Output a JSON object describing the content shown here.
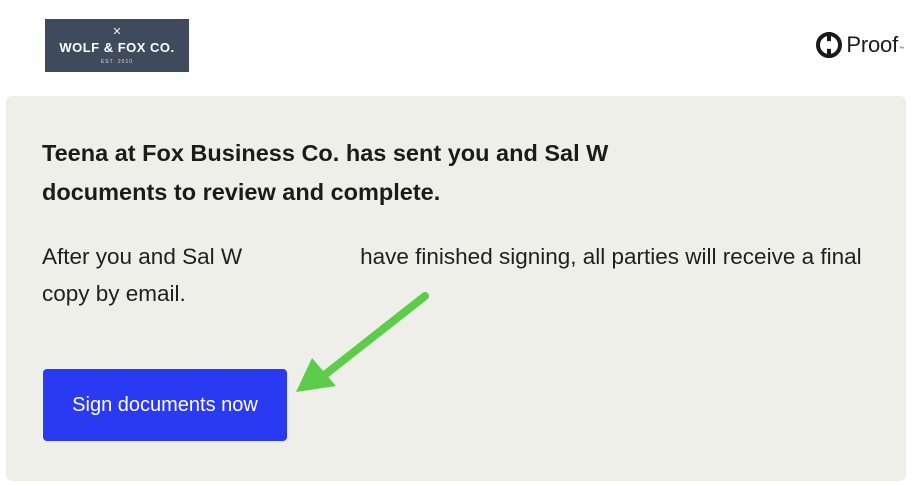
{
  "header": {
    "brand_logo": {
      "mark": "✕",
      "name": "WOLF & FOX CO.",
      "established": "EST. 2010"
    },
    "provider_logo": {
      "icon": "proof-logo-icon",
      "name": "Proof",
      "trademark": "™"
    }
  },
  "message": {
    "headline": "Teena at Fox Business Co. has sent you and Sal W documents to review and complete.",
    "body_part1": "After you and Sal W",
    "body_part2": "have finished signing, all parties will receive a final copy by email.",
    "cta_label": "Sign documents now"
  },
  "annotation": {
    "arrow_color": "#5ccc4a",
    "icon": "arrow-annotation-icon"
  },
  "colors": {
    "card_background": "#efefea",
    "button_background": "#2a3af2",
    "brand_logo_background": "#3f4a5c"
  }
}
